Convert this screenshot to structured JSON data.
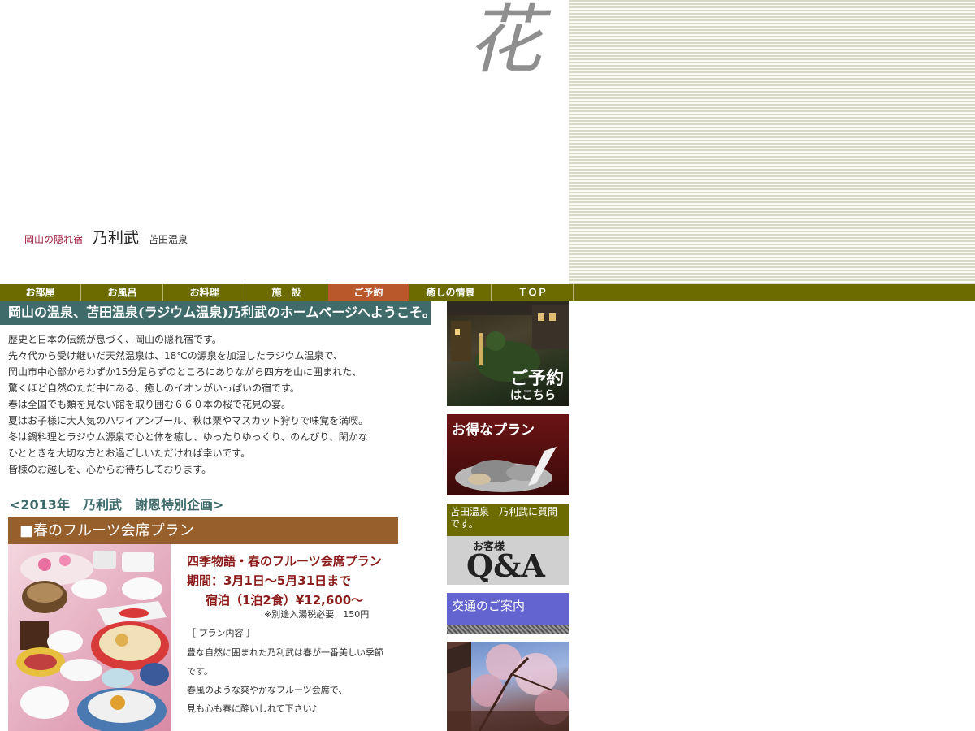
{
  "header": {
    "kanji": "花",
    "tag_hidden": "岡山の隠れ宿",
    "inn_name": "乃利武",
    "onsen": "苫田温泉"
  },
  "nav": {
    "items": [
      {
        "label": "お部屋"
      },
      {
        "label": "お風呂"
      },
      {
        "label": "お料理"
      },
      {
        "label": "施　設"
      },
      {
        "label": "ご予約"
      },
      {
        "label": "癒しの情景"
      },
      {
        "label": "ＴＯＰ"
      }
    ],
    "active_index": 4
  },
  "main": {
    "welcome": "岡山の温泉、苫田温泉(ラジウム温泉)乃利武のホームページへようこそ。",
    "intro_lines": [
      "歴史と日本の伝統が息づく、岡山の隠れ宿です。",
      "先々代から受け継いだ天然温泉は、18℃の源泉を加温したラジウム温泉で、",
      "岡山市中心部からわずか15分足らずのところにありながら四方を山に囲まれた、",
      "驚くほど自然のただ中にある、癒しのイオンがいっぱいの宿です。",
      "春は全国でも類を見ない館を取り囲む６６０本の桜で花見の宴。",
      "夏はお子様に大人気のハワイアンプール、秋は栗やマスカット狩りで味覚を満喫。",
      "冬は鍋料理とラジウム源泉で心と体を癒し、ゆったりゆっくり、のんびり、閑かな",
      "ひとときを大切な方とお過ごしいただければ幸いです。",
      "皆様のお越しを、心からお待ちしております。"
    ],
    "campaign_title": "<2013年　乃利武　謝恩特別企画>",
    "plan": {
      "header": "■春のフルーツ会席プラン",
      "title": "四季物語・春のフルーツ会席プラン",
      "period": "期間：3月1日～5月31日まで",
      "price": "宿泊（1泊2食）¥12,600～",
      "note": "※別途入湯税必要　150円",
      "contents_label": "［ プラン内容 ］",
      "desc_lines": [
        "豊な自然に囲まれた乃利武は春が一番美しい季節",
        "です。",
        "春風のような爽やかなフルーツ会席で、",
        "見も心も春に酔いしれて下さい♪"
      ]
    }
  },
  "sidebar": {
    "reserve": {
      "line1": "ご予約",
      "line2": "はこちら"
    },
    "deals": "お得なプラン",
    "qa": {
      "top": "苫田温泉　乃利武に質問です。",
      "sub": "お客様",
      "big": "Q&A"
    },
    "access": "交通のご案内"
  },
  "colors": {
    "nav_bg": "#6b6b00",
    "nav_active": "#b9582a",
    "welcome_bg": "#3f6b6b",
    "plan_header_bg": "#965f2c",
    "plan_text": "#8b1a1a"
  }
}
